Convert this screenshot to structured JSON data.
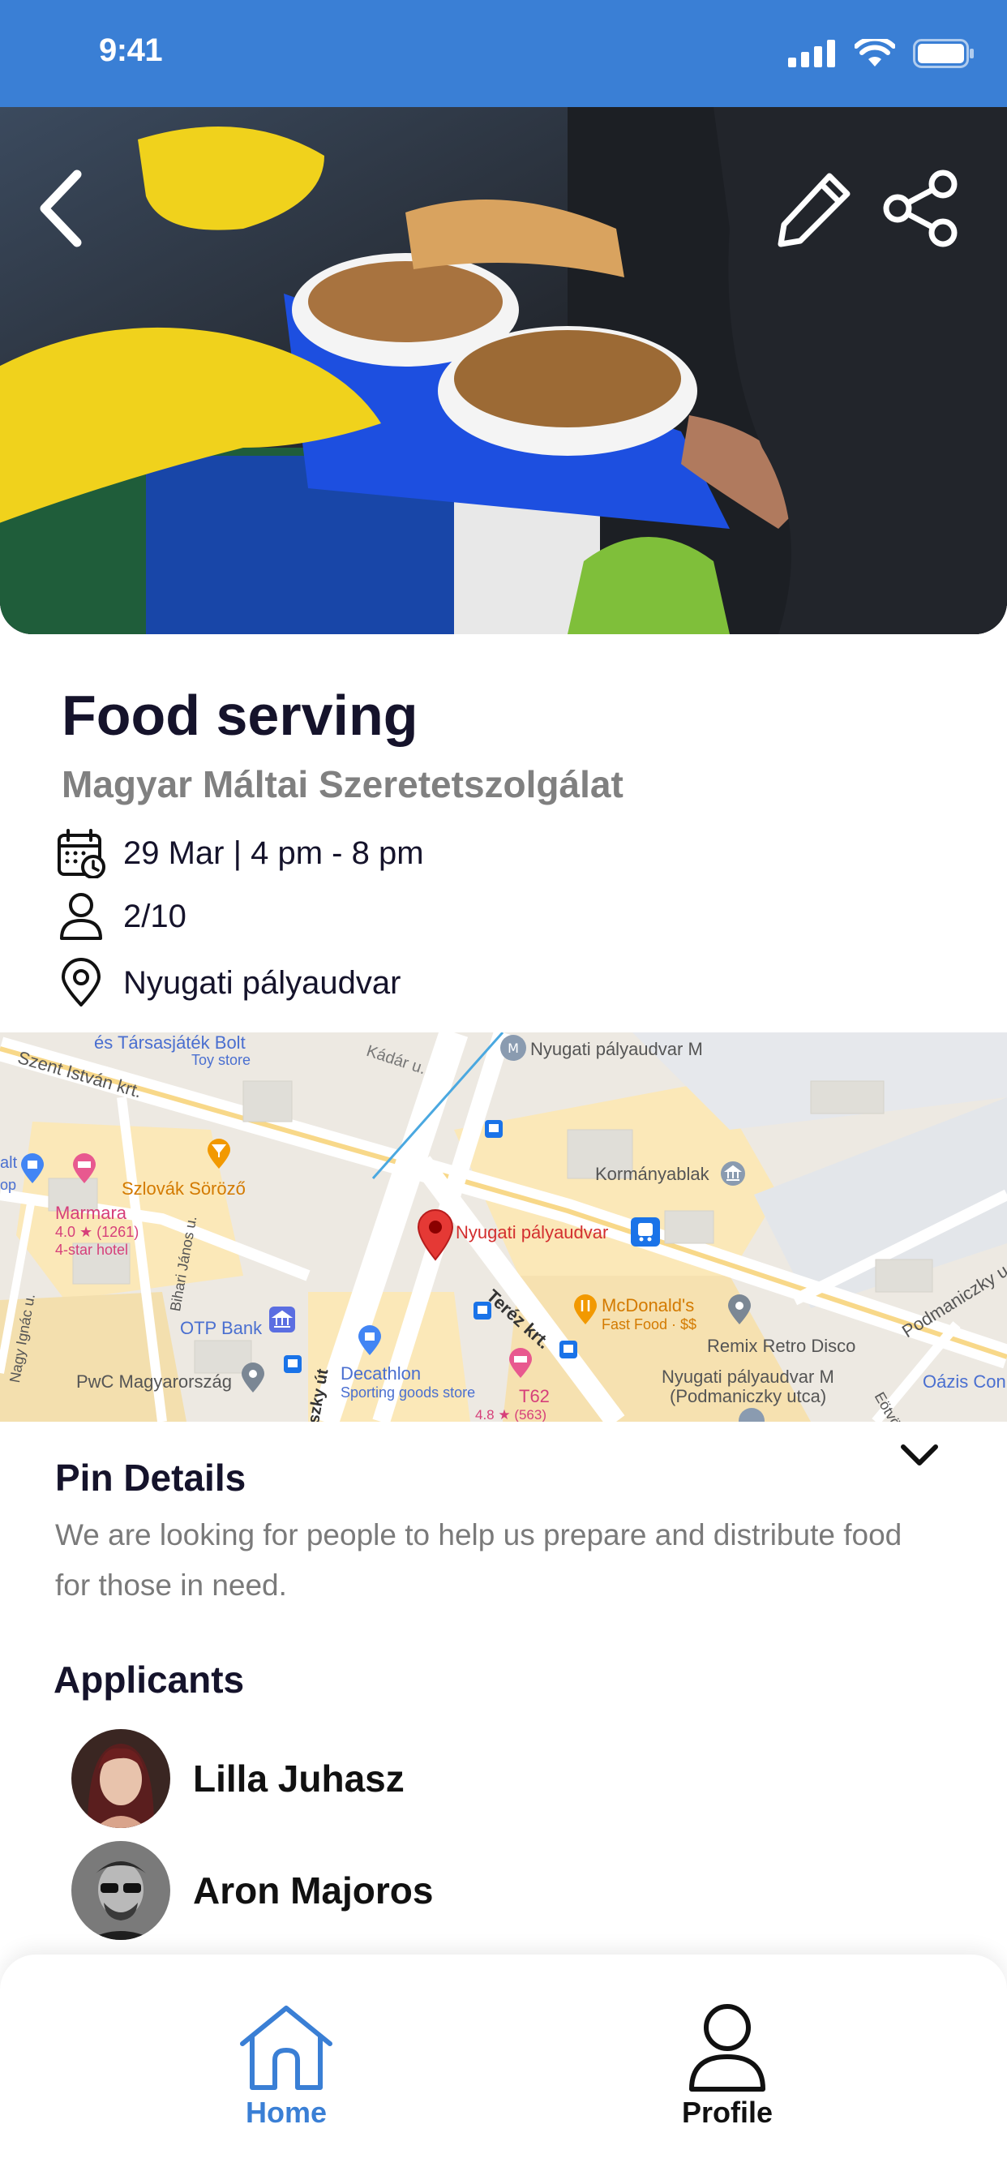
{
  "status_bar": {
    "time": "9:41"
  },
  "event": {
    "title": "Food serving",
    "organization": "Magyar Máltai Szeretetszolgálat",
    "datetime": "29 Mar | 4 pm - 8 pm",
    "capacity": "2/10",
    "location": "Nyugati pályaudvar"
  },
  "map": {
    "labels": {
      "l1": "és Társasjáték Bolt",
      "l2": "Toy store",
      "l3": "Szent István krt.",
      "l4": "Kádár u.",
      "l5": "Nyugati pályaudvar M",
      "l6": "Kormányablak",
      "l7": "Szlovák Söröző",
      "l8": "Marmara",
      "l9": "4.0 ★ (1261)",
      "l10": "4-star hotel",
      "l11": "Nyugati pályaudvar",
      "l12": "Bihari János u.",
      "l13": "OTP Bank",
      "l14": "Teréz krt.",
      "l15": "McDonald's",
      "l16": "Fast Food · $$",
      "l17": "Remix Retro Disco",
      "l18": "Podmaniczky u.",
      "l19": "Nagy Ignác u.",
      "l20": "PwC Magyarország",
      "l21": "Decathlon",
      "l22": "Sporting goods store",
      "l23": "T62",
      "l24": "4.8 ★ (563)",
      "l25": "Nyugati pályaudvar M",
      "l26": "(Podmaniczky utca)",
      "l27": "Oázis Con",
      "l28": "Eötvös",
      "l29": "szky út",
      "l30": "alt",
      "l31": "op"
    }
  },
  "pin_details": {
    "title": "Pin Details",
    "description": "We are looking for people to help us prepare and distribute food for those in need."
  },
  "applicants": {
    "title": "Applicants",
    "items": [
      {
        "name": "Lilla Juhasz"
      },
      {
        "name": "Aron Majoros"
      }
    ]
  },
  "tabbar": {
    "home": "Home",
    "profile": "Profile"
  },
  "colors": {
    "primary": "#3a7fd5",
    "text": "#15132b",
    "muted": "#7a7a7a",
    "map_pin": "#e53935"
  }
}
